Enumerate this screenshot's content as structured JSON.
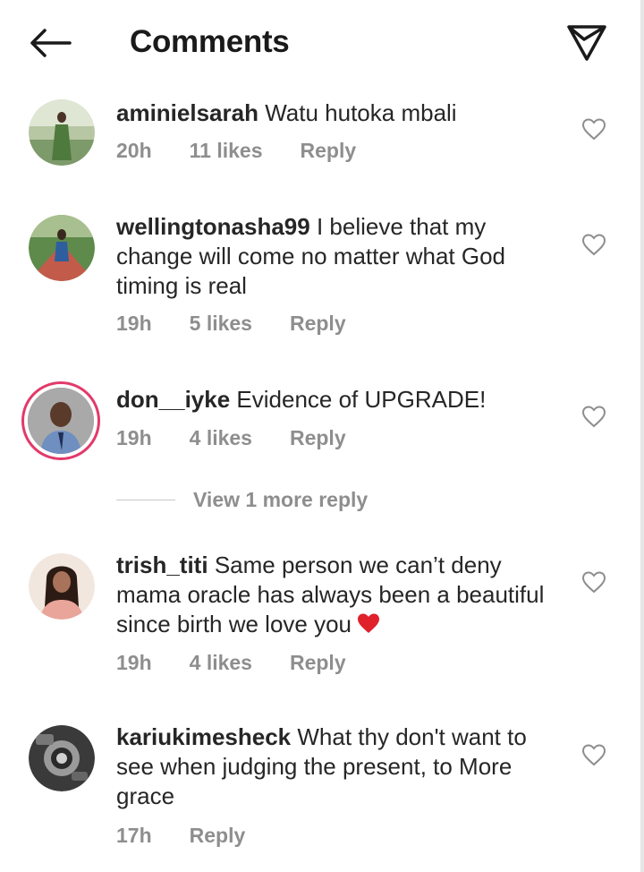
{
  "header": {
    "title": "Comments",
    "back_icon": "back-arrow-icon",
    "send_icon": "send-icon"
  },
  "comments": [
    {
      "username": "aminielsarah",
      "text": "Watu hutoka mbali",
      "time": "20h",
      "likes": "11 likes",
      "reply": "Reply"
    },
    {
      "username": "wellingtonasha99",
      "text": "I believe that my change will come no matter what God timing is real",
      "time": "19h",
      "likes": "5 likes",
      "reply": "Reply"
    },
    {
      "username": "don__iyke",
      "text": "Evidence of UPGRADE!",
      "time": "19h",
      "likes": "4 likes",
      "reply": "Reply",
      "story_ring": true
    },
    {
      "username": "trish_titi",
      "text": "Same person  we can’t  deny mama oracle has always been a beautiful since birth we love you",
      "time": "19h",
      "likes": "4 likes",
      "reply": "Reply",
      "emoji": "red-heart"
    },
    {
      "username": "kariukimesheck",
      "text": "What thy don't want to see when judging the present, to More grace",
      "time": "17h",
      "likes": "",
      "reply": "Reply"
    }
  ],
  "view_more": {
    "label": "View 1 more reply"
  },
  "colors": {
    "text": "#262626",
    "muted": "#8e8e8e",
    "story_ring": "#e23a6a",
    "heart_emoji": "#e0202b"
  }
}
